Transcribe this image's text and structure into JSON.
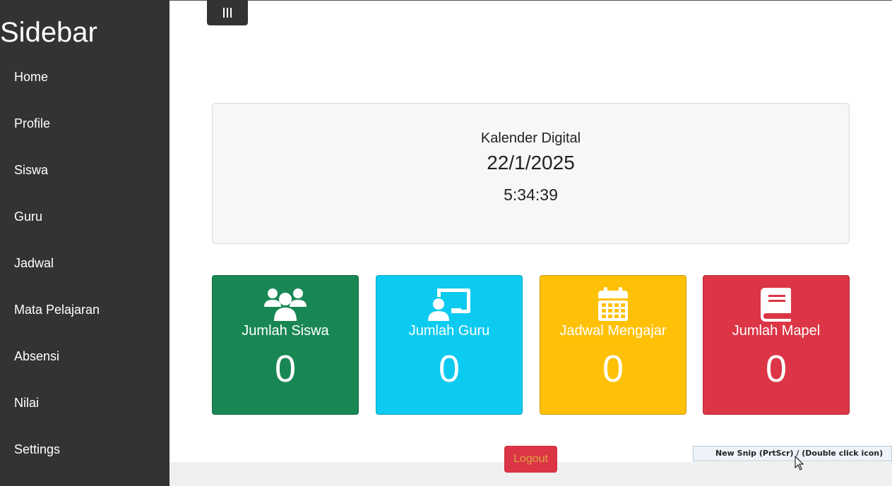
{
  "sidebar": {
    "title": "Sidebar",
    "items": [
      {
        "label": "Home"
      },
      {
        "label": "Profile"
      },
      {
        "label": "Siswa"
      },
      {
        "label": "Guru"
      },
      {
        "label": "Jadwal"
      },
      {
        "label": "Mata Pelajaran"
      },
      {
        "label": "Absensi"
      },
      {
        "label": "Nilai"
      },
      {
        "label": "Settings"
      }
    ]
  },
  "toggle": {
    "icon": "hamburger-icon"
  },
  "calendar": {
    "title": "Kalender Digital",
    "date": "22/1/2025",
    "time": "5:34:39"
  },
  "cards": {
    "siswa": {
      "label": "Jumlah Siswa",
      "value": "0",
      "icon": "users-icon",
      "color": "#198754"
    },
    "guru": {
      "label": "Jumlah Guru",
      "value": "0",
      "icon": "teacher-icon",
      "color": "#0dcaf0"
    },
    "jadwal": {
      "label": "Jadwal Mengajar",
      "value": "0",
      "icon": "calendar-icon",
      "color": "#ffc107"
    },
    "mapel": {
      "label": "Jumlah Mapel",
      "value": "0",
      "icon": "book-icon",
      "color": "#dc3545"
    }
  },
  "logout": {
    "label": "Logout",
    "color": "#dc3545"
  },
  "snip_tooltip": {
    "text": "New Snip (PrtScr) / (Double click icon)"
  }
}
